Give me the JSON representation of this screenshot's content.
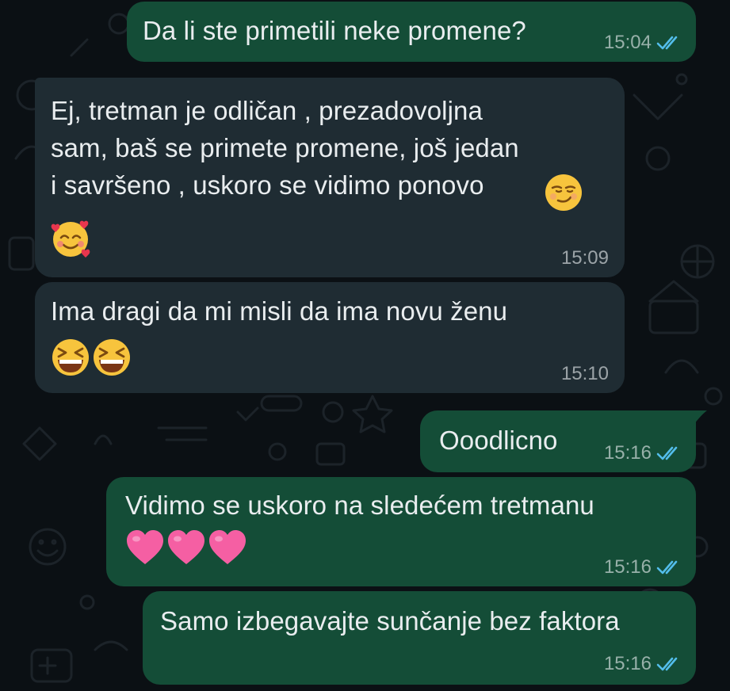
{
  "chat": {
    "messages": [
      {
        "id": "m1",
        "direction": "outgoing",
        "text": "Da li ste primetili neke promene?",
        "time": "15:04",
        "status": "read"
      },
      {
        "id": "m2",
        "direction": "incoming",
        "text": "Ej, tretman je odličan , prezadovoljna\nsam, baš se primete promene, još jedan\ni savršeno , uskoro se vidimo ponovo",
        "emoji": [
          "smirking-face",
          "smiling-face-with-hearts"
        ],
        "time": "15:09"
      },
      {
        "id": "m3",
        "direction": "incoming",
        "text": "Ima dragi da mi misli da ima novu ženu",
        "emoji": [
          "grinning-squinting-face",
          "grinning-squinting-face"
        ],
        "time": "15:10"
      },
      {
        "id": "m4",
        "direction": "outgoing",
        "text": "Ooodlicno",
        "time": "15:16",
        "status": "read"
      },
      {
        "id": "m5",
        "direction": "outgoing",
        "text": "Vidimo se uskoro na sledećem tretmanu",
        "emoji": [
          "pink-heart",
          "pink-heart",
          "pink-heart"
        ],
        "time": "15:16",
        "status": "read"
      },
      {
        "id": "m6",
        "direction": "outgoing",
        "text": "Samo izbegavajte sunčanje bez faktora",
        "time": "15:16",
        "status": "read"
      }
    ]
  },
  "colors": {
    "outgoing_bubble": "#144d37",
    "incoming_bubble": "#1f2c33",
    "background": "#0b1014",
    "read_tick": "#53bdeb",
    "text": "#e9edef"
  }
}
